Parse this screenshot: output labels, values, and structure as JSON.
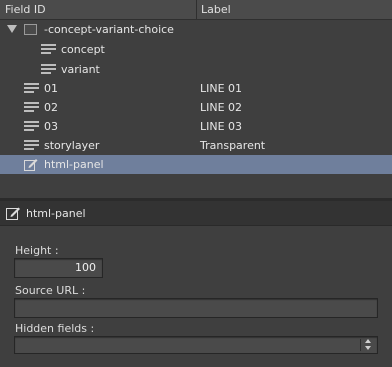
{
  "columns": {
    "field_id": "Field ID",
    "label": "Label"
  },
  "tree": {
    "group": {
      "name": "-concept-variant-choice",
      "children": [
        "concept",
        "variant"
      ]
    },
    "rows": [
      {
        "id": "01",
        "label": "LINE 01"
      },
      {
        "id": "02",
        "label": "LINE 02"
      },
      {
        "id": "03",
        "label": "LINE 03"
      },
      {
        "id": "storylayer",
        "label": "Transparent"
      },
      {
        "id": "html-panel",
        "label": ""
      }
    ],
    "selected": "html-panel"
  },
  "panel": {
    "title": "html-panel",
    "height_label": "Height :",
    "height_value": "100",
    "source_url_label": "Source URL :",
    "source_url_value": "",
    "hidden_fields_label": "Hidden fields :",
    "hidden_fields_value": ""
  },
  "icons": {
    "group_toggle": "expand-triangle-icon",
    "group": "folder-icon",
    "field": "text-field-icon",
    "html_panel": "edit-icon"
  },
  "colors": {
    "selection": "#6f7f9c",
    "background": "#3f3f3f"
  }
}
